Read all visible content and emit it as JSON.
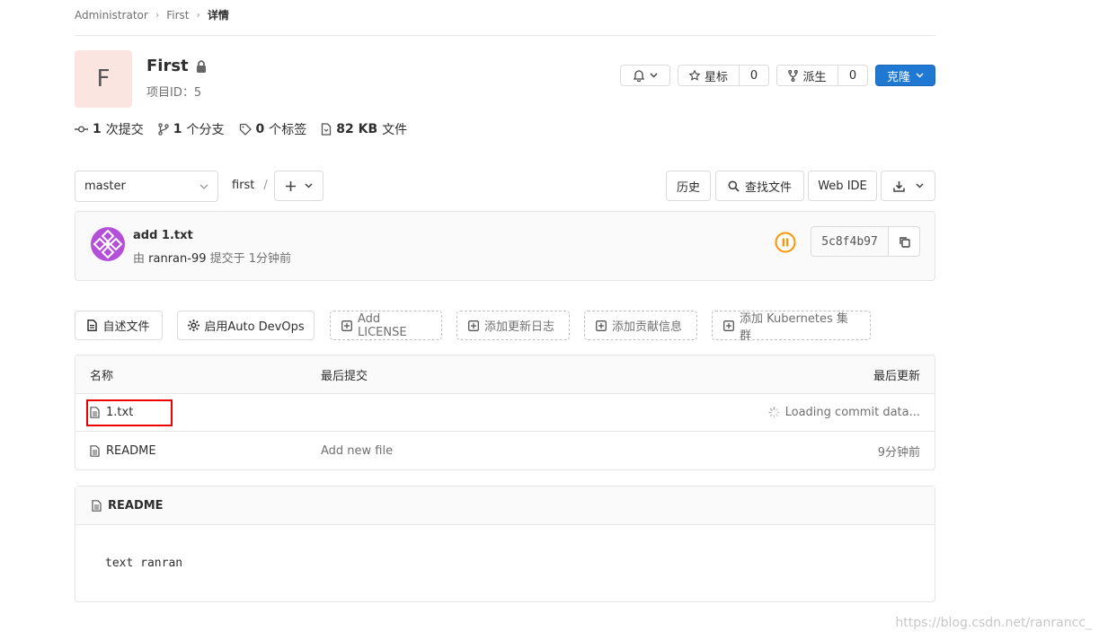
{
  "breadcrumb": {
    "items": [
      "Administrator",
      "First"
    ],
    "current": "详情"
  },
  "project": {
    "avatar_letter": "F",
    "name": "First",
    "id_label": "项目ID：5"
  },
  "actions": {
    "star_label": "星标",
    "star_count": "0",
    "fork_label": "派生",
    "fork_count": "0",
    "clone_label": "克隆"
  },
  "stats": {
    "commits_num": "1",
    "commits_label": "次提交",
    "branches_num": "1",
    "branches_label": "个分支",
    "tags_num": "0",
    "tags_label": "个标签",
    "files_num": "82 KB",
    "files_label": "文件"
  },
  "branch_bar": {
    "branch": "master",
    "path": "first",
    "path_sep": "/",
    "history_label": "历史",
    "find_file_label": "查找文件",
    "web_ide_label": "Web IDE"
  },
  "commit": {
    "title": "add 1.txt",
    "by_prefix": "由",
    "author": "ranran-99",
    "by_suffix": "提交于 1分钟前",
    "sha": "5c8f4b97"
  },
  "suggestions": {
    "readme": "自述文件",
    "devops": "启用Auto DevOps",
    "license": "Add LICENSE",
    "changelog": "添加更新日志",
    "contrib": "添加贡献信息",
    "k8s": "添加 Kubernetes 集群"
  },
  "file_table": {
    "headers": {
      "name": "名称",
      "last_commit": "最后提交",
      "last_update": "最后更新"
    },
    "rows": [
      {
        "name": "1.txt",
        "commit": "",
        "updated": "Loading commit data..."
      },
      {
        "name": "README",
        "commit": "Add new file",
        "updated": "9分钟前"
      }
    ]
  },
  "readme": {
    "title": "README",
    "content": "text ranran"
  },
  "watermark": "https://blog.csdn.net/ranrancc_",
  "colors": {
    "primary": "#1f78d1",
    "pipeline_running": "#fc9403",
    "highlight": "#e00000",
    "avatar_bg": "#fbe5e1",
    "user_avatar": "#b44fd8"
  }
}
